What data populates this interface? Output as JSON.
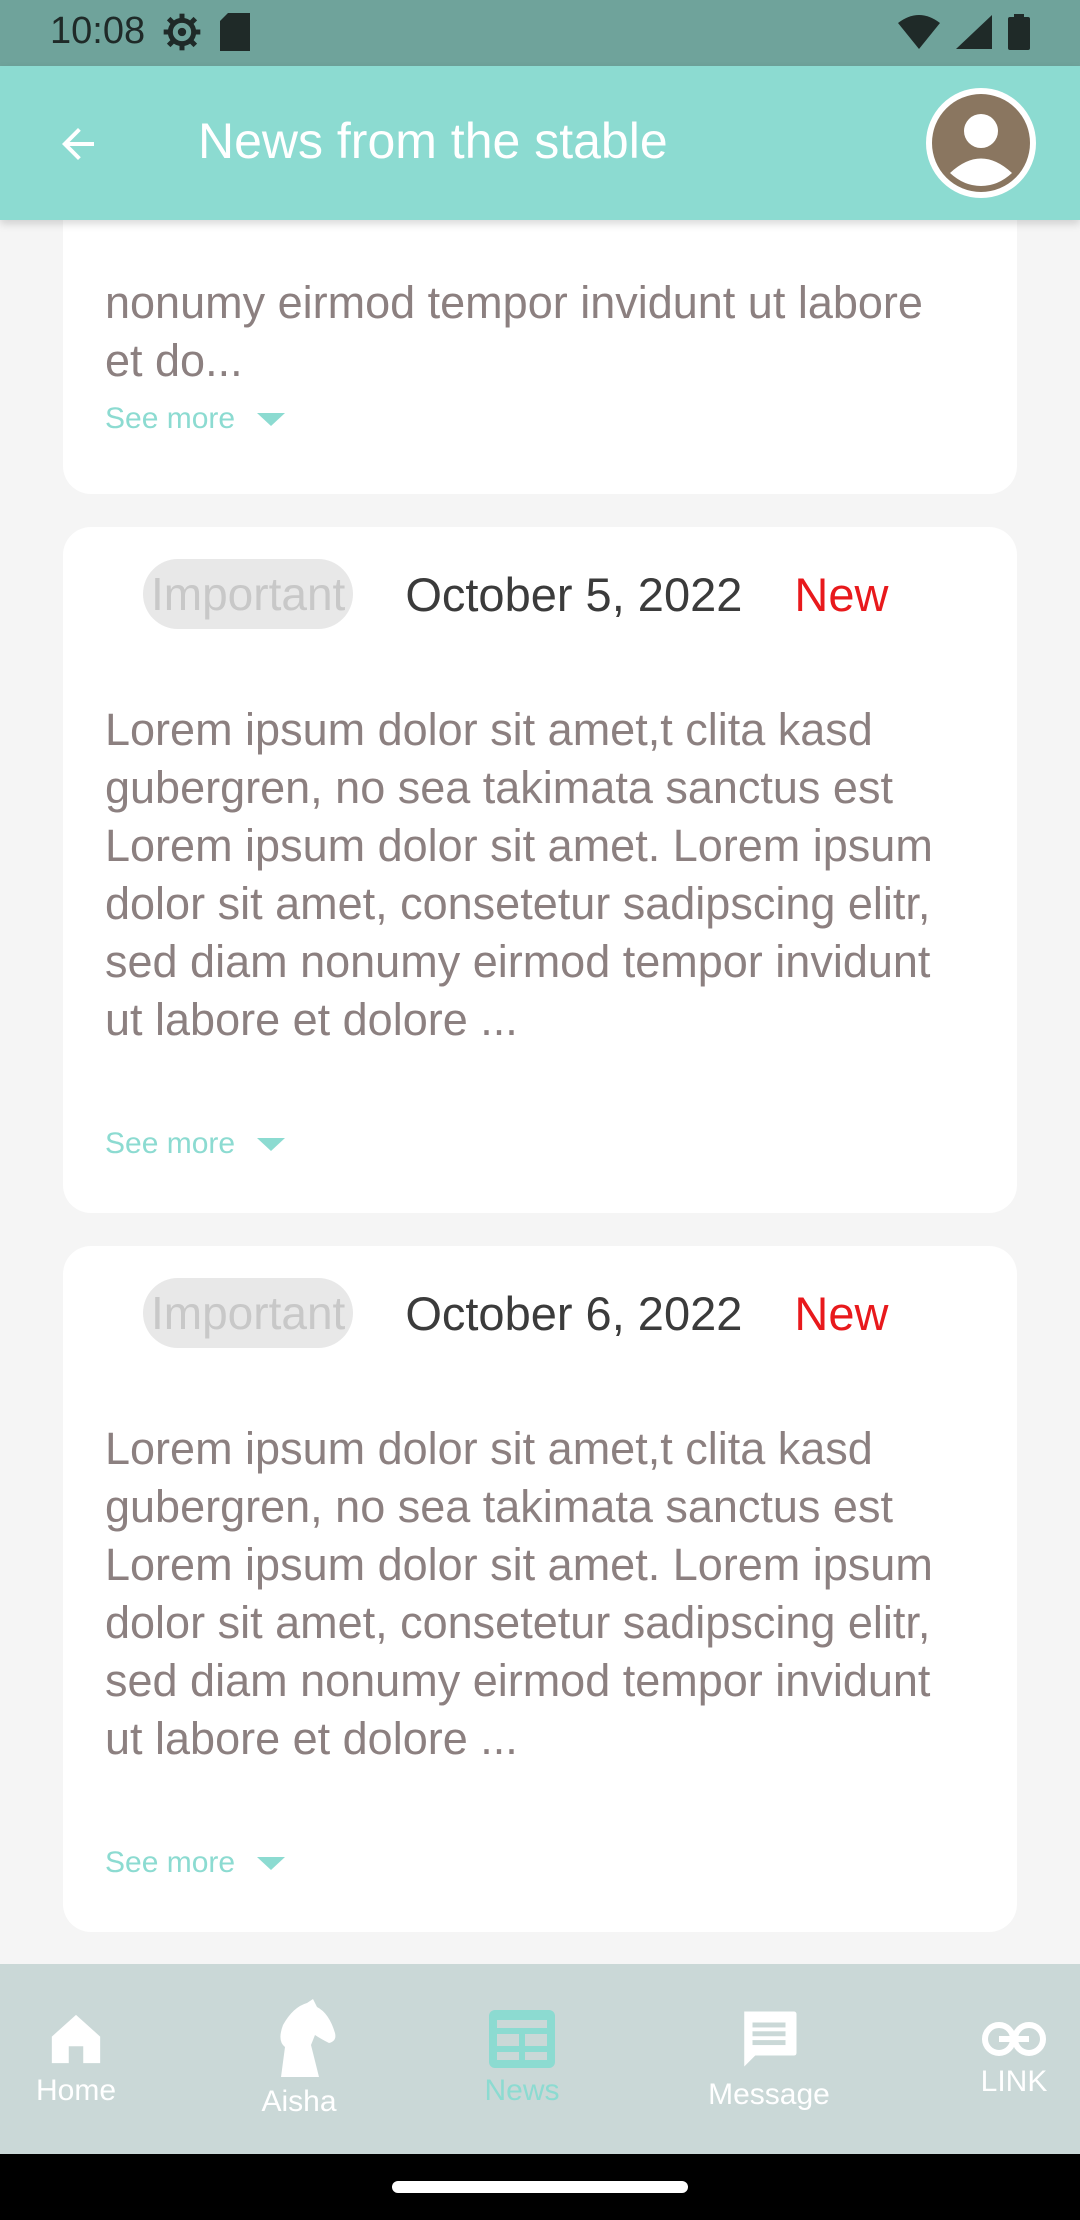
{
  "status_bar": {
    "time": "10:08"
  },
  "app_bar": {
    "title": "News from the stable"
  },
  "cards": [
    {
      "text": "nonumy eirmod tempor invidunt ut labore et do...",
      "see_more": "See more"
    },
    {
      "tag": "Important",
      "date": "October 5, 2022",
      "new_label": "New",
      "text": "Lorem ipsum dolor sit amet,t clita kasd gubergren, no sea takimata sanctus est Lorem ipsum dolor sit amet. Lorem ipsum dolor sit amet, consetetur sadipscing elitr, sed diam nonumy eirmod tempor invidunt ut labore et dolore ...",
      "see_more": "See more"
    },
    {
      "tag": "Important",
      "date": "October 6, 2022",
      "new_label": "New",
      "text": "Lorem ipsum dolor sit amet,t clita kasd gubergren, no sea takimata sanctus est Lorem ipsum dolor sit amet. Lorem ipsum dolor sit amet, consetetur sadipscing elitr, sed diam nonumy eirmod tempor invidunt ut labore et dolore ...",
      "see_more": "See more"
    }
  ],
  "bottom_nav": {
    "items": [
      {
        "label": "Home",
        "icon": "home-icon"
      },
      {
        "label": "Aisha",
        "icon": "horse-icon"
      },
      {
        "label": "News",
        "icon": "news-icon",
        "active": true
      },
      {
        "label": "Message",
        "icon": "message-icon"
      },
      {
        "label": "LINK",
        "icon": "link-icon"
      }
    ]
  },
  "colors": {
    "accent": "#8cdbd1",
    "status_bar": "#6fa39b",
    "new_label": "#e8191c",
    "nav_bg": "#cad8d7"
  }
}
